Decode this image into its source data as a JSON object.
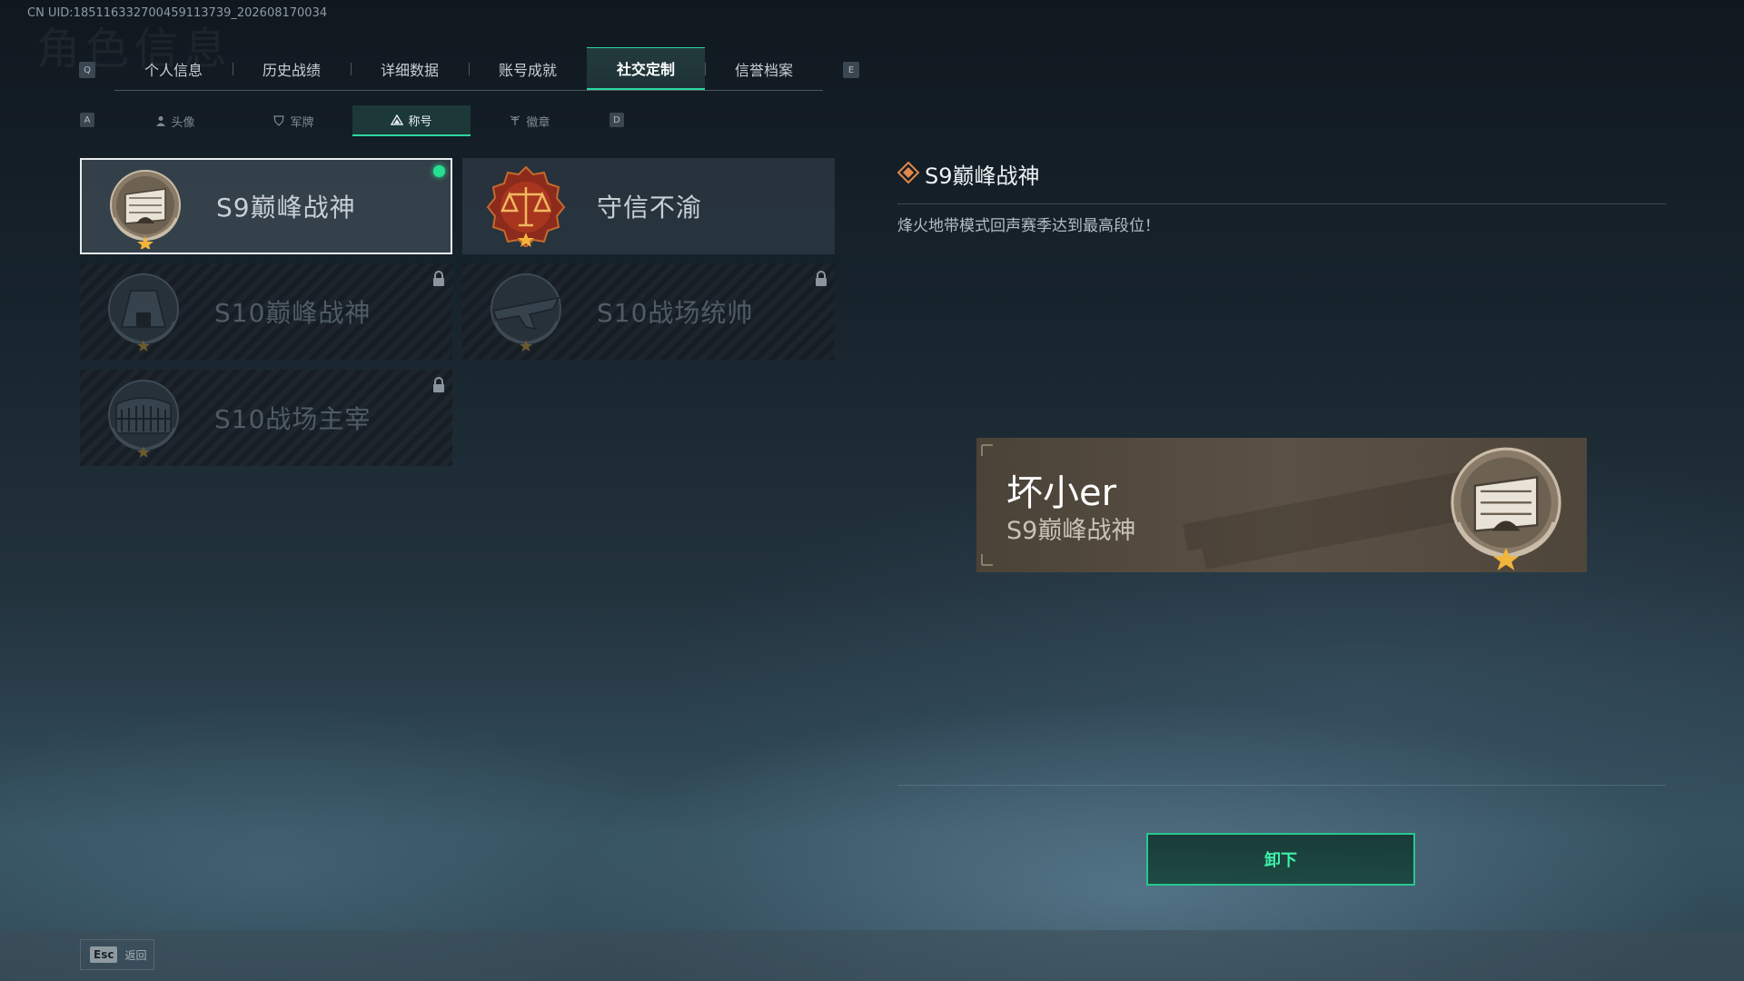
{
  "uid": "CN UID:185116332700459113739_202608170034",
  "ghost_title": "角色信息",
  "keys": {
    "prev_tab": "Q",
    "next_tab": "E",
    "prev_sub": "A",
    "next_sub": "D"
  },
  "tabs": [
    {
      "label": "个人信息",
      "active": false
    },
    {
      "label": "历史战绩",
      "active": false
    },
    {
      "label": "详细数据",
      "active": false
    },
    {
      "label": "账号成就",
      "active": false
    },
    {
      "label": "社交定制",
      "active": true
    },
    {
      "label": "信誉档案",
      "active": false
    }
  ],
  "subtabs": [
    {
      "label": "头像",
      "icon": "person-icon",
      "active": false
    },
    {
      "label": "军牌",
      "icon": "shield-icon",
      "active": false
    },
    {
      "label": "称号",
      "icon": "triangle-icon",
      "active": true
    },
    {
      "label": "徽章",
      "icon": "wing-icon",
      "active": false
    }
  ],
  "titles": [
    {
      "label": "S9巅峰战神",
      "state": "selected",
      "equipped": true,
      "badge": "fortress-badge-icon"
    },
    {
      "label": "守信不渝",
      "state": "owned",
      "equipped": false,
      "badge": "scales-badge-icon"
    },
    {
      "label": "S10巅峰战神",
      "state": "locked",
      "equipped": false,
      "badge": "dam-badge-icon"
    },
    {
      "label": "S10战场统帅",
      "state": "locked",
      "equipped": false,
      "badge": "aircraft-badge-icon"
    },
    {
      "label": "S10战场主宰",
      "state": "locked",
      "equipped": false,
      "badge": "colosseum-badge-icon"
    }
  ],
  "detail": {
    "title": "S9巅峰战神",
    "description": "烽火地带模式回声赛季达到最高段位！"
  },
  "preview": {
    "player_name": "坏小er",
    "title": "S9巅峰战神"
  },
  "actions": {
    "unequip": "卸下"
  },
  "footer": {
    "esc_key": "Esc",
    "back_label": "返回"
  },
  "colors": {
    "accent": "#2fd6a0",
    "equipped_dot": "#26e08f",
    "button_text": "#3ff0a8"
  }
}
